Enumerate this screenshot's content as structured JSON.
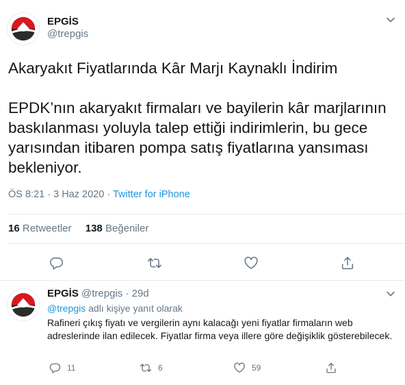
{
  "tweet": {
    "display_name": "EPGİS",
    "handle": "@trepgis",
    "text": "Akaryakıt Fiyatlarında Kâr Marjı Kaynaklı İndirim\n\nEPDK’nın akaryakıt firmaları ve bayilerin kâr marjlarının baskılanması yoluyla talep ettiği indirimlerin, bu gece yarısından itibaren pompa satış fiyatlarına yansıması bekleniyor.",
    "time": "ÖS 8:21",
    "date": "3 Haz 2020",
    "separator": "·",
    "source": "Twitter for iPhone",
    "retweet_count": "16",
    "retweet_label": "Retweetler",
    "like_count": "138",
    "like_label": "Beğeniler",
    "icons": [
      "reply-icon",
      "retweet-icon",
      "like-icon",
      "share-icon",
      "chevron-down-icon"
    ]
  },
  "reply": {
    "display_name": "EPGİS",
    "handle": "@trepgis",
    "dot": "·",
    "age": "29d",
    "reply_to_mention": "@trepgis",
    "reply_to_suffix": " adlı kişiye yanıt olarak",
    "text": "Rafineri çıkış fiyatı ve vergilerin aynı kalacağı yeni fiyatlar firmaların web adreslerinde ilan edilecek. Fiyatlar firma veya illere göre değişiklik gösterebilecek.",
    "reply_count": "11",
    "retweet_count": "6",
    "like_count": "59"
  },
  "colors": {
    "text": "#14171a",
    "secondary": "#657786",
    "link": "#1b95e0",
    "border": "#e6ecf0",
    "logo_red": "#d71920",
    "logo_dark": "#2b2b2b"
  }
}
